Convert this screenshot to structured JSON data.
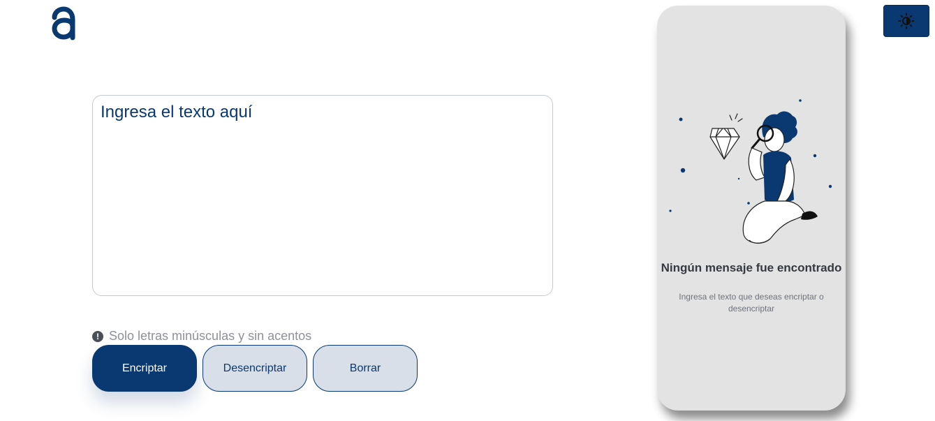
{
  "header": {
    "logo_icon": "alura-a-logo",
    "theme_toggle_icon": "sun-icon"
  },
  "input": {
    "placeholder": "Ingresa el texto aquí",
    "value": ""
  },
  "hint": {
    "icon": "exclamation-circle-icon",
    "text": "Solo letras minúsculas y sin acentos"
  },
  "buttons": {
    "encrypt_label": "Encriptar",
    "decrypt_label": "Desencriptar",
    "clear_label": "Borrar"
  },
  "output": {
    "illustration": "person-magnifying-glass-diamond",
    "title": "Ningún mensaje fue encontrado",
    "subtitle": "Ingresa el texto que deseas encriptar o desencriptar"
  },
  "colors": {
    "primary": "#0a3871",
    "secondary_bg": "#d8dfe8",
    "panel_bg": "#e3e3e3",
    "hint_text": "#8d9198"
  }
}
